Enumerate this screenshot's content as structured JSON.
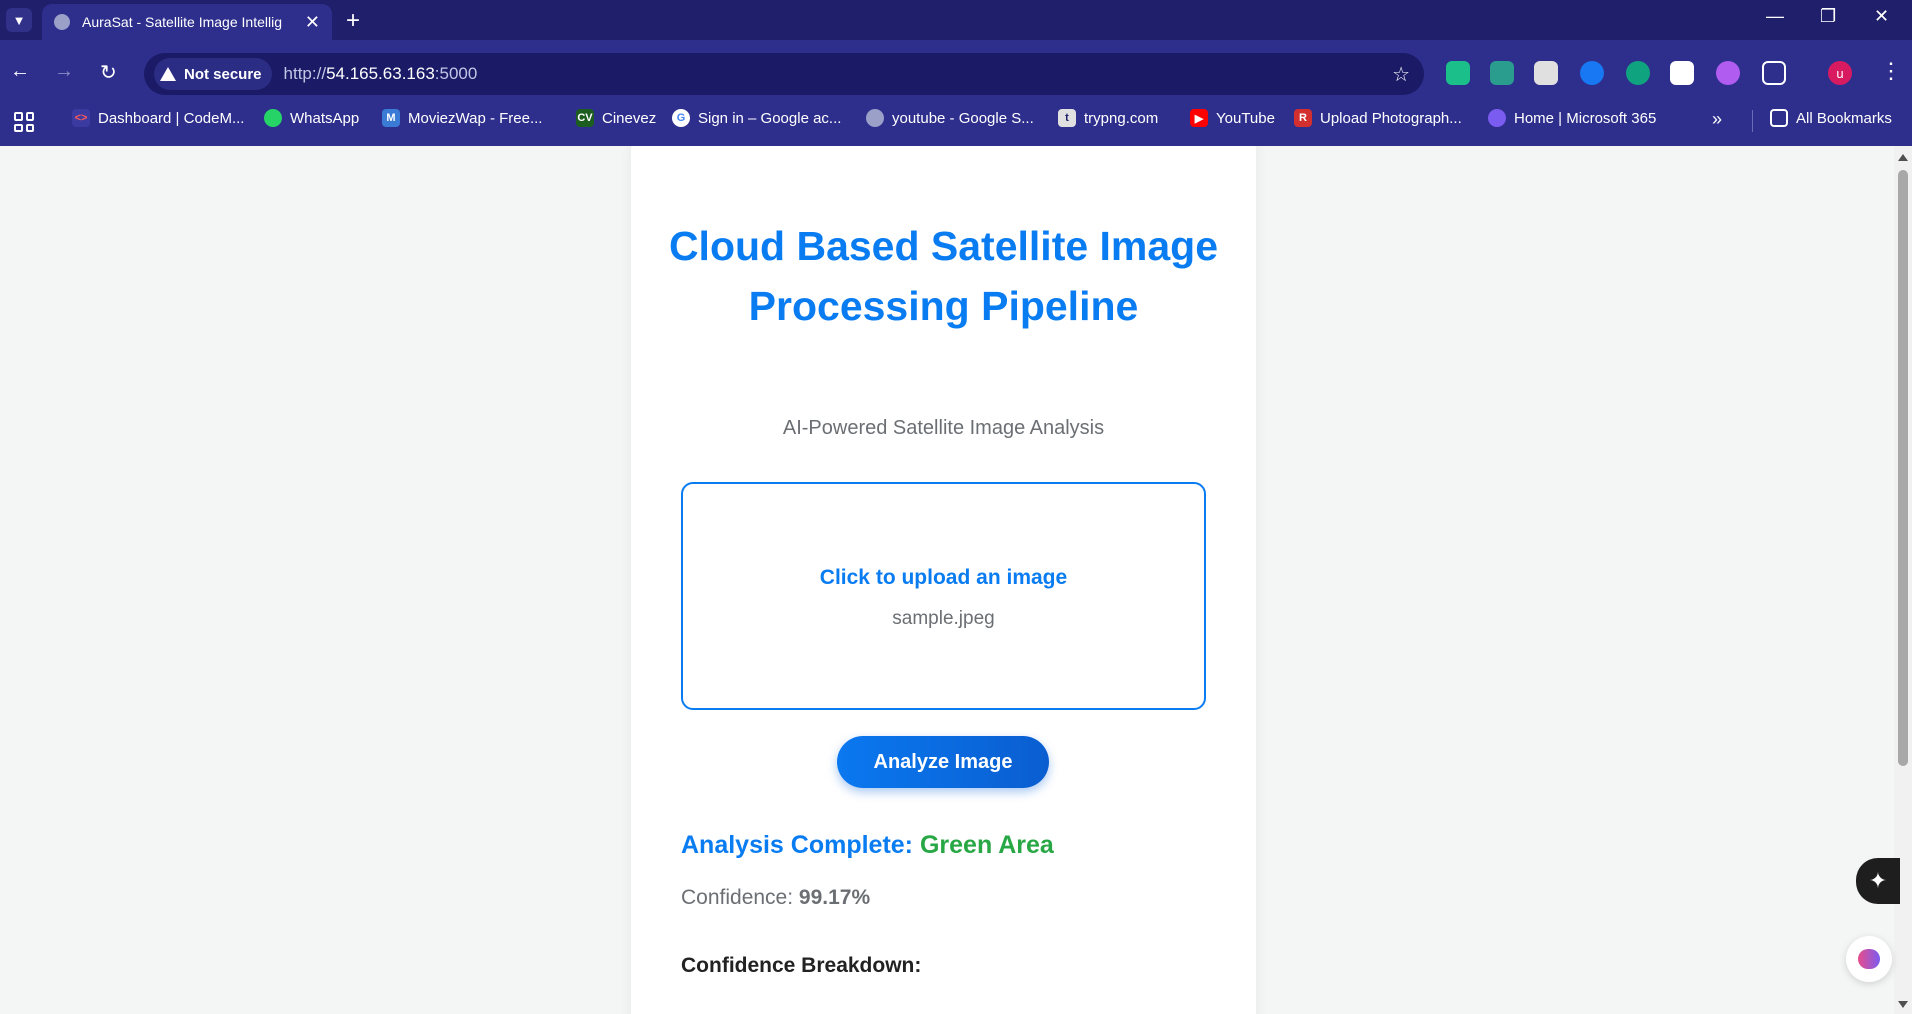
{
  "browser": {
    "tab_title": "AuraSat - Satellite Image Intellig",
    "security_label": "Not secure",
    "url_scheme": "http://",
    "url_host": "54.165.63.163",
    "url_port": ":5000",
    "avatar_letter": "u",
    "bookmarks": [
      {
        "label": "Dashboard | CodeM...",
        "icon": "code-icon",
        "color": "#1f1f6b"
      },
      {
        "label": "WhatsApp",
        "icon": "whatsapp-icon",
        "color": "#25d366"
      },
      {
        "label": "MoviezWap - Free...",
        "icon": "moviezwap-icon",
        "color": "#3a7bd5"
      },
      {
        "label": "Cinevez",
        "icon": "cinevez-icon",
        "color": "#2e7d32"
      },
      {
        "label": "Sign in – Google ac...",
        "icon": "google-icon",
        "color": "#ffffff"
      },
      {
        "label": "youtube - Google S...",
        "icon": "globe-icon",
        "color": "#9aa0c8"
      },
      {
        "label": "trypng.com",
        "icon": "trypng-icon",
        "color": "#e0e0e0"
      },
      {
        "label": "YouTube",
        "icon": "youtube-icon",
        "color": "#ff0000"
      },
      {
        "label": "Upload Photograph...",
        "icon": "r-icon",
        "color": "#d32f2f"
      },
      {
        "label": "Home | Microsoft 365",
        "icon": "microsoft365-icon",
        "color": "#7b5cf0"
      }
    ],
    "all_bookmarks_label": "All Bookmarks"
  },
  "page": {
    "title": "Cloud Based Satellite Image Processing Pipeline",
    "subtitle": "AI-Powered Satellite Image Analysis",
    "upload_label": "Click to upload an image",
    "upload_filename": "sample.jpeg",
    "analyze_button": "Analyze Image",
    "result_prefix": "Analysis Complete:",
    "result_class": "Green Area",
    "confidence_label": "Confidence:",
    "confidence_value": "99.17%",
    "breakdown_heading": "Confidence Breakdown:"
  },
  "colors": {
    "accent": "#0a7cf2",
    "result_green": "#28a745",
    "chrome": "#2e2f8d"
  }
}
